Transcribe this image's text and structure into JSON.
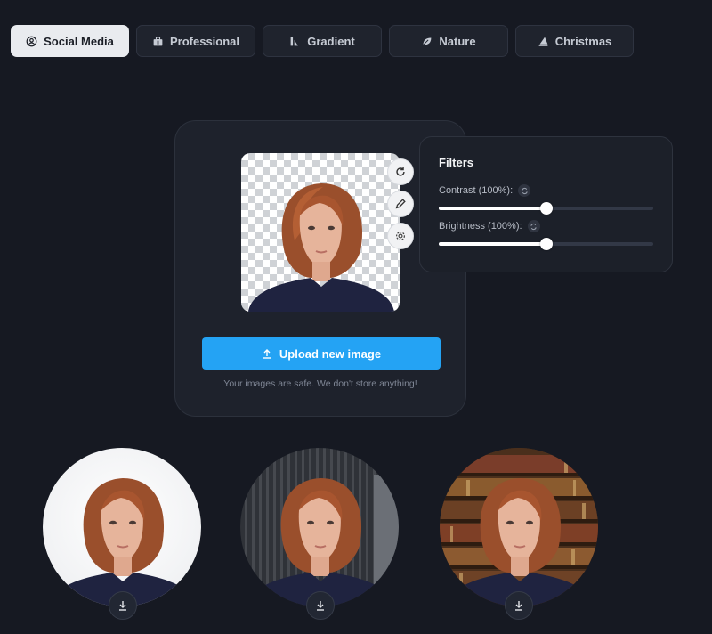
{
  "tabs": [
    {
      "label": "Social Media",
      "icon": "user-circle-icon",
      "active": true
    },
    {
      "label": "Professional",
      "icon": "briefcase-icon",
      "active": false
    },
    {
      "label": "Gradient",
      "icon": "gradient-icon",
      "active": false
    },
    {
      "label": "Nature",
      "icon": "leaf-icon",
      "active": false
    },
    {
      "label": "Christmas",
      "icon": "tree-icon",
      "active": false
    }
  ],
  "editor": {
    "tools": [
      {
        "name": "rotate-icon"
      },
      {
        "name": "pen-icon"
      },
      {
        "name": "settings-icon"
      }
    ],
    "upload_label": "Upload new image",
    "safe_note": "Your images are safe. We don't store anything!"
  },
  "filters": {
    "title": "Filters",
    "contrast_label": "Contrast (100%):",
    "contrast_value": 0.5,
    "brightness_label": "Brightness (100%):",
    "brightness_value": 0.5
  },
  "results": [
    {
      "background": "white",
      "download_icon": "download-icon"
    },
    {
      "background": "dark-stripes",
      "download_icon": "download-icon"
    },
    {
      "background": "bookshelf",
      "download_icon": "download-icon"
    }
  ],
  "colors": {
    "accent": "#24a3f4",
    "background": "#161922",
    "card": "#1e222c",
    "hair": "#a0522d",
    "shirt": "#1f2340",
    "skin": "#e8b59b"
  }
}
